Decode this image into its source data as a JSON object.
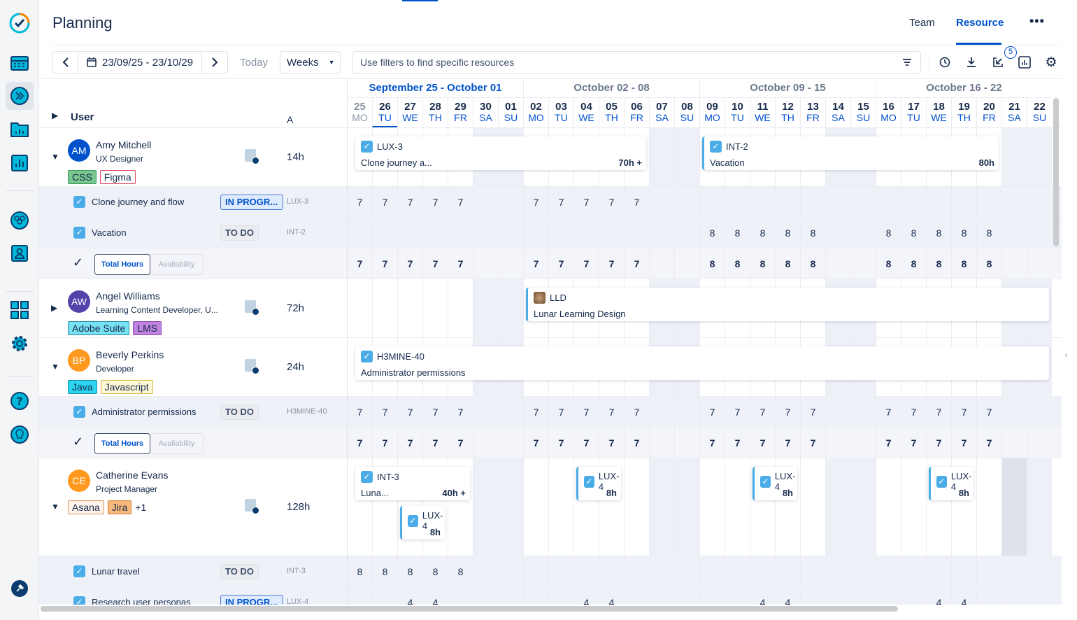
{
  "header": {
    "title": "Planning",
    "tabs": [
      {
        "label": "Team",
        "active": false
      },
      {
        "label": "Resource",
        "active": true
      }
    ],
    "more_icon": "more-horizontal-icon"
  },
  "sidebar": {
    "items": [
      "logo-check-icon",
      "calendar-icon",
      "forward-icon",
      "folder-chart-icon",
      "bar-chart-icon",
      "team-icon",
      "user-card-icon",
      "grid-icon",
      "gear-icon",
      "help-icon",
      "lightbulb-icon",
      "pin-icon"
    ]
  },
  "toolbar": {
    "date_range": "23/09/25 - 23/10/29",
    "today": "Today",
    "view": "Weeks",
    "filter_placeholder": "Use filters to find specific resources",
    "badge": "5"
  },
  "colors": {
    "accent": "#0052cc",
    "checkbox": "#4bade8",
    "weekend": "#eef0f8",
    "task_bg": "#eef1f8"
  },
  "columns": {
    "user": "User",
    "allocation": "A"
  },
  "weeks": [
    {
      "label": "September 25 - October 01",
      "current": true
    },
    {
      "label": "October 02 - 08",
      "current": false
    },
    {
      "label": "October 09 - 15",
      "current": false
    },
    {
      "label": "October 16 - 22",
      "current": false
    }
  ],
  "days": [
    {
      "n": "25",
      "d": "MO"
    },
    {
      "n": "26",
      "d": "TU"
    },
    {
      "n": "27",
      "d": "WE"
    },
    {
      "n": "28",
      "d": "TH"
    },
    {
      "n": "29",
      "d": "FR"
    },
    {
      "n": "30",
      "d": "SA"
    },
    {
      "n": "01",
      "d": "SU"
    },
    {
      "n": "02",
      "d": "MO"
    },
    {
      "n": "03",
      "d": "TU"
    },
    {
      "n": "04",
      "d": "WE"
    },
    {
      "n": "05",
      "d": "TH"
    },
    {
      "n": "06",
      "d": "FR"
    },
    {
      "n": "07",
      "d": "SA"
    },
    {
      "n": "08",
      "d": "SU"
    },
    {
      "n": "09",
      "d": "MO"
    },
    {
      "n": "10",
      "d": "TU"
    },
    {
      "n": "11",
      "d": "WE"
    },
    {
      "n": "12",
      "d": "TH"
    },
    {
      "n": "13",
      "d": "FR"
    },
    {
      "n": "14",
      "d": "SA"
    },
    {
      "n": "15",
      "d": "SU"
    },
    {
      "n": "16",
      "d": "MO"
    },
    {
      "n": "17",
      "d": "TU"
    },
    {
      "n": "18",
      "d": "WE"
    },
    {
      "n": "19",
      "d": "TH"
    },
    {
      "n": "20",
      "d": "FR"
    },
    {
      "n": "21",
      "d": "SA"
    },
    {
      "n": "22",
      "d": "SU"
    }
  ],
  "today_index": 1,
  "users": [
    {
      "initials": "AM",
      "name": "Amy Mitchell",
      "role": "UX Designer",
      "avatar_color": "#0052cc",
      "expanded": true,
      "hours": "14h",
      "skills": [
        {
          "label": "CSS",
          "bg": "#79c78f",
          "border": "#3e9a57"
        },
        {
          "label": "Figma",
          "bg": "#fff",
          "border": "#e0455f"
        }
      ],
      "extra": "",
      "bars": [
        {
          "key": "LUX-3",
          "title": "Clone journey a...",
          "hours": "70h +",
          "start": 0,
          "end": 11,
          "lane": 0,
          "left_border": false
        },
        {
          "key": "INT-2",
          "title": "Vacation",
          "hours": "80h",
          "start": 14,
          "end": 25,
          "lane": 0,
          "left_border": true
        }
      ],
      "tasks": [
        {
          "title": "Clone journey and flow",
          "status": "IN PROGR...",
          "status_type": "progress",
          "key": "LUX-3",
          "hours": [
            "7",
            "7",
            "7",
            "7",
            "7",
            "",
            "",
            "7",
            "7",
            "7",
            "7",
            "7",
            "",
            "",
            "",
            "",
            "",
            "",
            "",
            "",
            "",
            "",
            "",
            "",
            "",
            "",
            "",
            ""
          ]
        },
        {
          "title": "Vacation",
          "status": "TO DO",
          "status_type": "todo",
          "key": "INT-2",
          "hours": [
            "",
            "",
            "",
            "",
            "",
            "",
            "",
            "",
            "",
            "",
            "",
            "",
            "",
            "",
            "8",
            "8",
            "8",
            "8",
            "8",
            "",
            "",
            "8",
            "8",
            "8",
            "8",
            "8",
            "",
            ""
          ]
        }
      ],
      "total": {
        "hours": [
          "7",
          "7",
          "7",
          "7",
          "7",
          "",
          "",
          "7",
          "7",
          "7",
          "7",
          "7",
          "",
          "",
          "8",
          "8",
          "8",
          "8",
          "8",
          "",
          "",
          "8",
          "8",
          "8",
          "8",
          "8",
          "",
          ""
        ]
      }
    },
    {
      "initials": "AW",
      "name": "Angel Williams",
      "role": "Learning Content Developer, U...",
      "avatar_color": "#5243aa",
      "expanded": false,
      "hours": "72h",
      "skills": [
        {
          "label": "Adobe Suite",
          "bg": "#79e2f2",
          "border": "#2a8a99"
        },
        {
          "label": "LMS",
          "bg": "#c084e0",
          "border": "#8a4bb0"
        }
      ],
      "extra": "",
      "bars": [
        {
          "key": "LLD",
          "title": "Lunar Learning Design",
          "hours": "",
          "start": 7,
          "end": 27,
          "lane": 0,
          "left_border": true,
          "project_icon": true
        }
      ],
      "tasks": [],
      "total": null
    },
    {
      "initials": "BP",
      "name": "Beverly Perkins",
      "role": "Developer",
      "avatar_color": "#ff991f",
      "expanded": true,
      "hours": "24h",
      "skills": [
        {
          "label": "Java",
          "bg": "#2bd4f0",
          "border": "#1a8fa3"
        },
        {
          "label": "Javascript",
          "bg": "#fff8d6",
          "border": "#d8b94a"
        }
      ],
      "extra": "",
      "bars": [
        {
          "key": "H3MINE-40",
          "title": "Administrator permissions",
          "hours": "",
          "start": 0,
          "end": 27,
          "lane": 0,
          "left_border": false
        }
      ],
      "tasks": [
        {
          "title": "Administrator permissions",
          "status": "TO DO",
          "status_type": "todo",
          "key": "H3MINE-40",
          "hours": [
            "7",
            "7",
            "7",
            "7",
            "7",
            "",
            "",
            "7",
            "7",
            "7",
            "7",
            "7",
            "",
            "",
            "7",
            "7",
            "7",
            "7",
            "7",
            "",
            "",
            "7",
            "7",
            "7",
            "7",
            "7",
            "",
            ""
          ]
        }
      ],
      "total": {
        "hours": [
          "7",
          "7",
          "7",
          "7",
          "7",
          "",
          "",
          "7",
          "7",
          "7",
          "7",
          "7",
          "",
          "",
          "7",
          "7",
          "7",
          "7",
          "7",
          "",
          "",
          "7",
          "7",
          "7",
          "7",
          "7",
          "",
          ""
        ]
      }
    },
    {
      "initials": "CE",
      "name": "Catherine Evans",
      "role": "Project Manager",
      "avatar_color": "#ff991f",
      "expanded": true,
      "hours": "128h",
      "skills": [
        {
          "label": "Asana",
          "bg": "#fff4ec",
          "border": "#e0925a"
        },
        {
          "label": "Jira",
          "bg": "#f6b97c",
          "border": "#d07a38"
        }
      ],
      "extra": "+1",
      "bars": [
        {
          "key": "INT-3",
          "title": "Luna...",
          "hours": "40h +",
          "start": 0,
          "end": 4,
          "lane": 0,
          "left_border": false
        },
        {
          "key": "LUX-4",
          "title": "",
          "hours": "8h",
          "start": 2,
          "end": 3,
          "lane": 1,
          "left_border": true
        },
        {
          "key": "LUX-4",
          "title": "",
          "hours": "8h",
          "start": 9,
          "end": 10,
          "lane": 0,
          "left_border": true
        },
        {
          "key": "LUX-4",
          "title": "",
          "hours": "8h",
          "start": 16,
          "end": 17,
          "lane": 0,
          "left_border": true
        },
        {
          "key": "LUX-4",
          "title": "",
          "hours": "8h",
          "start": 23,
          "end": 24,
          "lane": 0,
          "left_border": true
        }
      ],
      "tasks": [
        {
          "title": "Lunar travel",
          "status": "TO DO",
          "status_type": "todo",
          "key": "INT-3",
          "hours": [
            "8",
            "8",
            "8",
            "8",
            "8",
            "",
            "",
            "",
            "",
            "",
            "",
            "",
            "",
            "",
            "",
            "",
            "",
            "",
            "",
            "",
            "",
            "",
            "",
            "",
            "",
            "",
            "",
            ""
          ]
        },
        {
          "title": "Research user personas",
          "status": "IN PROGR...",
          "status_type": "progress",
          "key": "LUX-4",
          "hours": [
            "",
            "",
            "4",
            "4",
            "",
            "",
            "",
            "",
            "",
            "4",
            "4",
            "",
            "",
            "",
            "",
            "",
            "4",
            "4",
            "",
            "",
            "",
            "",
            "",
            "4",
            "4",
            "",
            "",
            ""
          ]
        }
      ],
      "total": null
    }
  ],
  "total_toggle": {
    "total_hours": "Total Hours",
    "availability": "Availability"
  }
}
